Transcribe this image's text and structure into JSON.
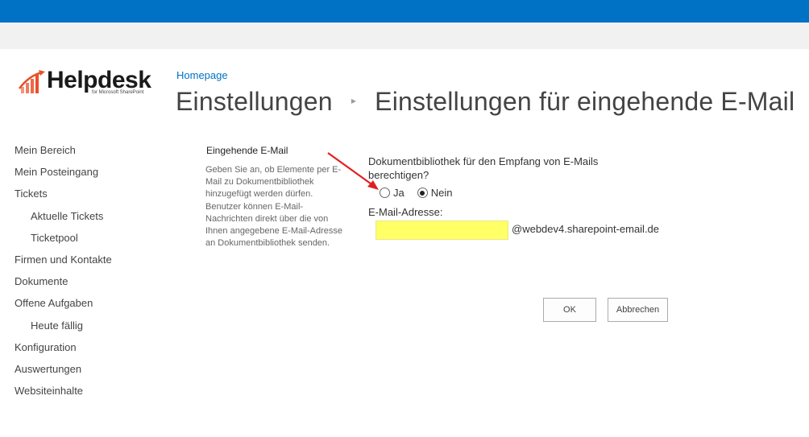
{
  "logo": {
    "name": "Helpdesk",
    "sub": "for Microsoft SharePoint"
  },
  "breadcrumb": {
    "homepage": "Homepage"
  },
  "title": {
    "parent": "Einstellungen",
    "separator": "▸",
    "current": "Einstellungen für eingehende E-Mail"
  },
  "nav": {
    "items": [
      {
        "label": "Mein Bereich",
        "level": 0
      },
      {
        "label": "Mein Posteingang",
        "level": 0
      },
      {
        "label": "Tickets",
        "level": 0
      },
      {
        "label": "Aktuelle Tickets",
        "level": 1
      },
      {
        "label": "Ticketpool",
        "level": 1
      },
      {
        "label": "Firmen und Kontakte",
        "level": 0
      },
      {
        "label": "Dokumente",
        "level": 0
      },
      {
        "label": "Offene Aufgaben",
        "level": 0
      },
      {
        "label": "Heute fällig",
        "level": 1
      },
      {
        "label": "Konfiguration",
        "level": 0
      },
      {
        "label": "Auswertungen",
        "level": 0
      },
      {
        "label": "Websiteinhalte",
        "level": 0
      }
    ]
  },
  "section": {
    "title": "Eingehende E-Mail",
    "description": "Geben Sie an, ob Elemente per E-Mail zu Dokumentbibliothek hinzugefügt werden dürfen. Benutzer können E-Mail-Nachrichten direkt über die von Ihnen angegebene E-Mail-Adresse an Dokumentbibliothek senden."
  },
  "form": {
    "question": "Dokumentbibliothek für den Empfang von E-Mails berechtigen?",
    "option_yes": "Ja",
    "option_no": "Nein",
    "selected": "Nein",
    "email_label": "E-Mail-Adresse:",
    "email_value": "",
    "email_domain": "@webdev4.sharepoint-email.de"
  },
  "buttons": {
    "ok": "OK",
    "cancel": "Abbrechen"
  },
  "colors": {
    "suite_bar": "#0072c6",
    "ribbon": "#f1f1f1",
    "link": "#0072c6",
    "logo_accent": "#e8502a",
    "highlight": "#ffff66",
    "annotation_arrow": "#e02020"
  }
}
